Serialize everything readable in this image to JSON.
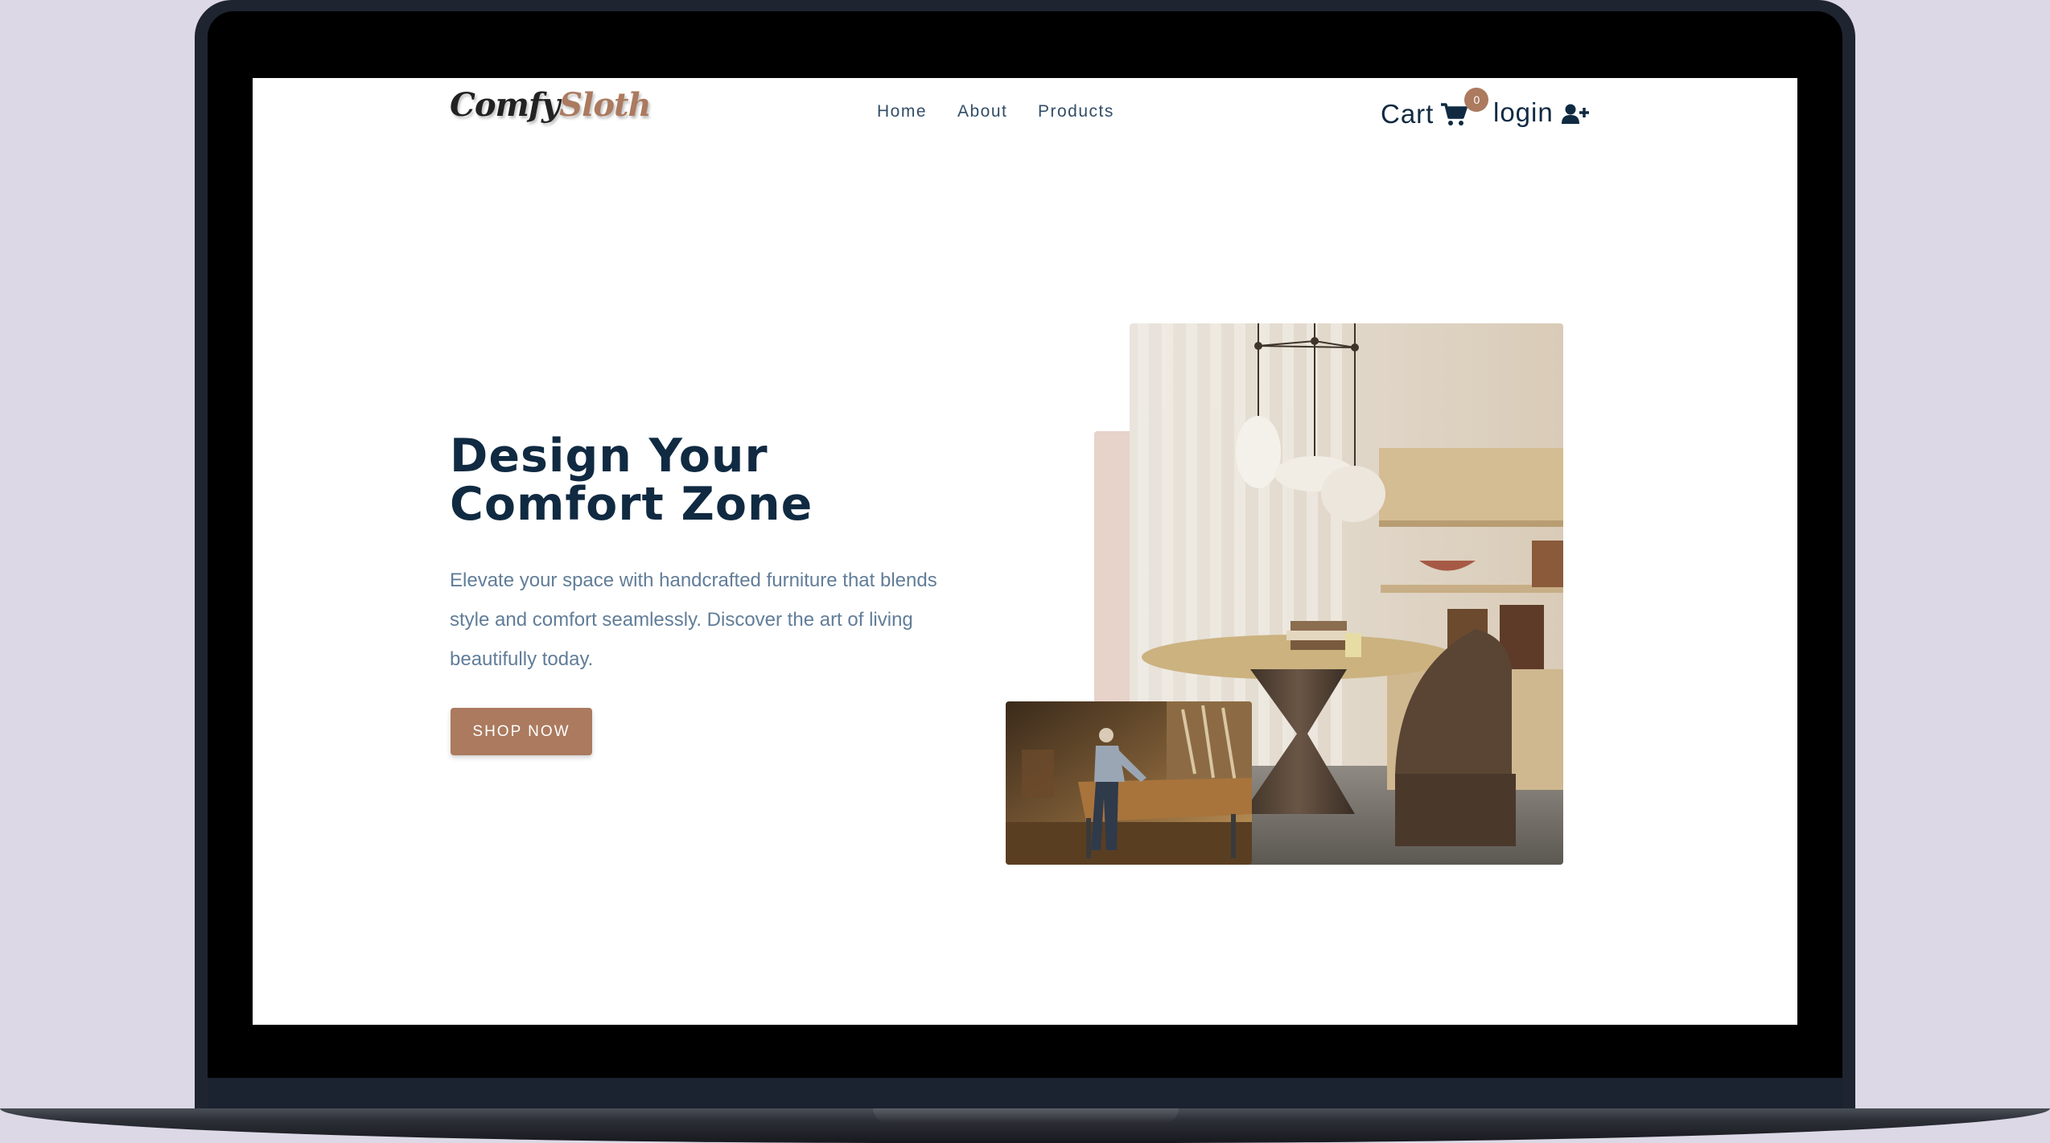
{
  "brand": {
    "logo_part1": "Comfy",
    "logo_part2": "Sloth"
  },
  "nav": {
    "links": [
      "Home",
      "About",
      "Products"
    ]
  },
  "cart": {
    "label": "Cart",
    "count": "0",
    "icon": "shopping-cart-icon"
  },
  "login": {
    "label": "login",
    "icon": "user-plus-icon"
  },
  "hero": {
    "title_line1": "Design Your",
    "title_line2": "Comfort Zone",
    "text": "Elevate your space with handcrafted furniture that blends style and comfort seamlessly. Discover the art of living beautifully today.",
    "button_label": "SHOP NOW"
  },
  "colors": {
    "accent": "#ab7a5f",
    "heading": "#102a42",
    "body_text": "#617d98",
    "accent_block": "#e7d3ca"
  }
}
